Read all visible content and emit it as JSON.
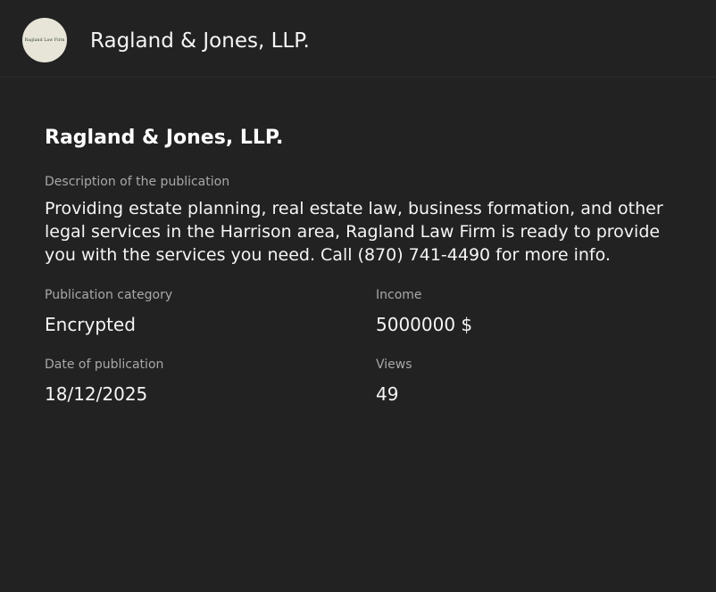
{
  "header": {
    "logo_text": "Ragland Law Firm",
    "title": "Ragland & Jones, LLP."
  },
  "publication": {
    "title": "Ragland & Jones, LLP.",
    "description_label": "Description of the publication",
    "description": "Providing estate planning, real estate law, business formation, and other legal services in the Harrison area, Ragland Law Firm is ready to provide you with the services you need. Call (870) 741-4490 for more info.",
    "category_label": "Publication category",
    "category": "Encrypted",
    "income_label": "Income",
    "income": "5000000 $",
    "date_label": "Date of publication",
    "date": "18/12/2025",
    "views_label": "Views",
    "views": "49"
  },
  "colors": {
    "background": "#222222",
    "avatar_bg": "#e7e5d7",
    "muted_text": "#a8a8a8",
    "primary_text": "#f5f5f5"
  },
  "icons": {
    "avatar": "firm-logo-icon"
  }
}
